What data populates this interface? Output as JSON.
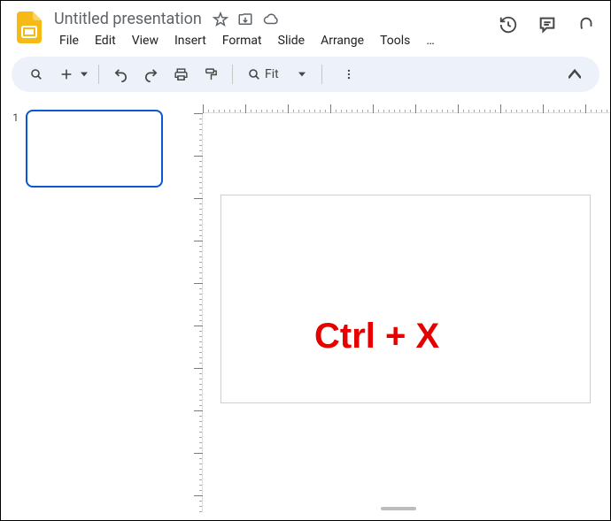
{
  "doc": {
    "title": "Untitled presentation"
  },
  "menus": {
    "file": "File",
    "edit": "Edit",
    "view": "View",
    "insert": "Insert",
    "format": "Format",
    "slide": "Slide",
    "arrange": "Arrange",
    "tools": "Tools",
    "more": "…"
  },
  "toolbar": {
    "zoom_label": "Fit"
  },
  "filmstrip": {
    "slide1_number": "1"
  },
  "overlay": {
    "text": "Ctrl + X"
  }
}
